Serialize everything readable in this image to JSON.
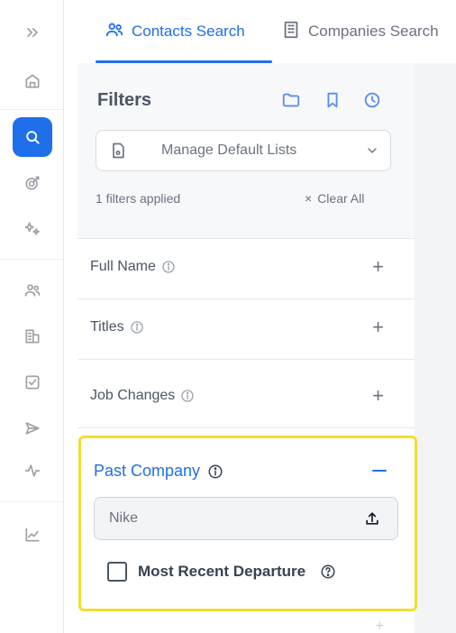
{
  "tabs": {
    "contacts_label": "Contacts Search",
    "companies_label": "Companies Search"
  },
  "filters": {
    "title": "Filters",
    "default_lists_label": "Manage Default Lists",
    "applied_text": "1 filters applied",
    "clear_all_label": "Clear All"
  },
  "filter_rows": [
    {
      "label": "Full Name",
      "action": "+"
    },
    {
      "label": "Titles",
      "action": "+"
    },
    {
      "label": "Job Changes",
      "action": "+"
    }
  ],
  "past_company": {
    "label": "Past Company",
    "input_value": "Nike",
    "checkbox_label": "Most Recent Departure"
  },
  "colors": {
    "accent": "#1f6feb",
    "highlight_border": "#f2de2e",
    "rail_active": "#1f6feb"
  },
  "icons": {
    "rail": [
      "double-chevron-icon",
      "home-icon",
      "search-icon",
      "target-icon",
      "sparkle-icon",
      "people-icon",
      "building-icon",
      "checklist-icon",
      "send-icon",
      "activity-icon",
      "chart-icon"
    ],
    "filters_header": [
      "folder-icon",
      "bookmark-icon",
      "clock-icon"
    ]
  }
}
